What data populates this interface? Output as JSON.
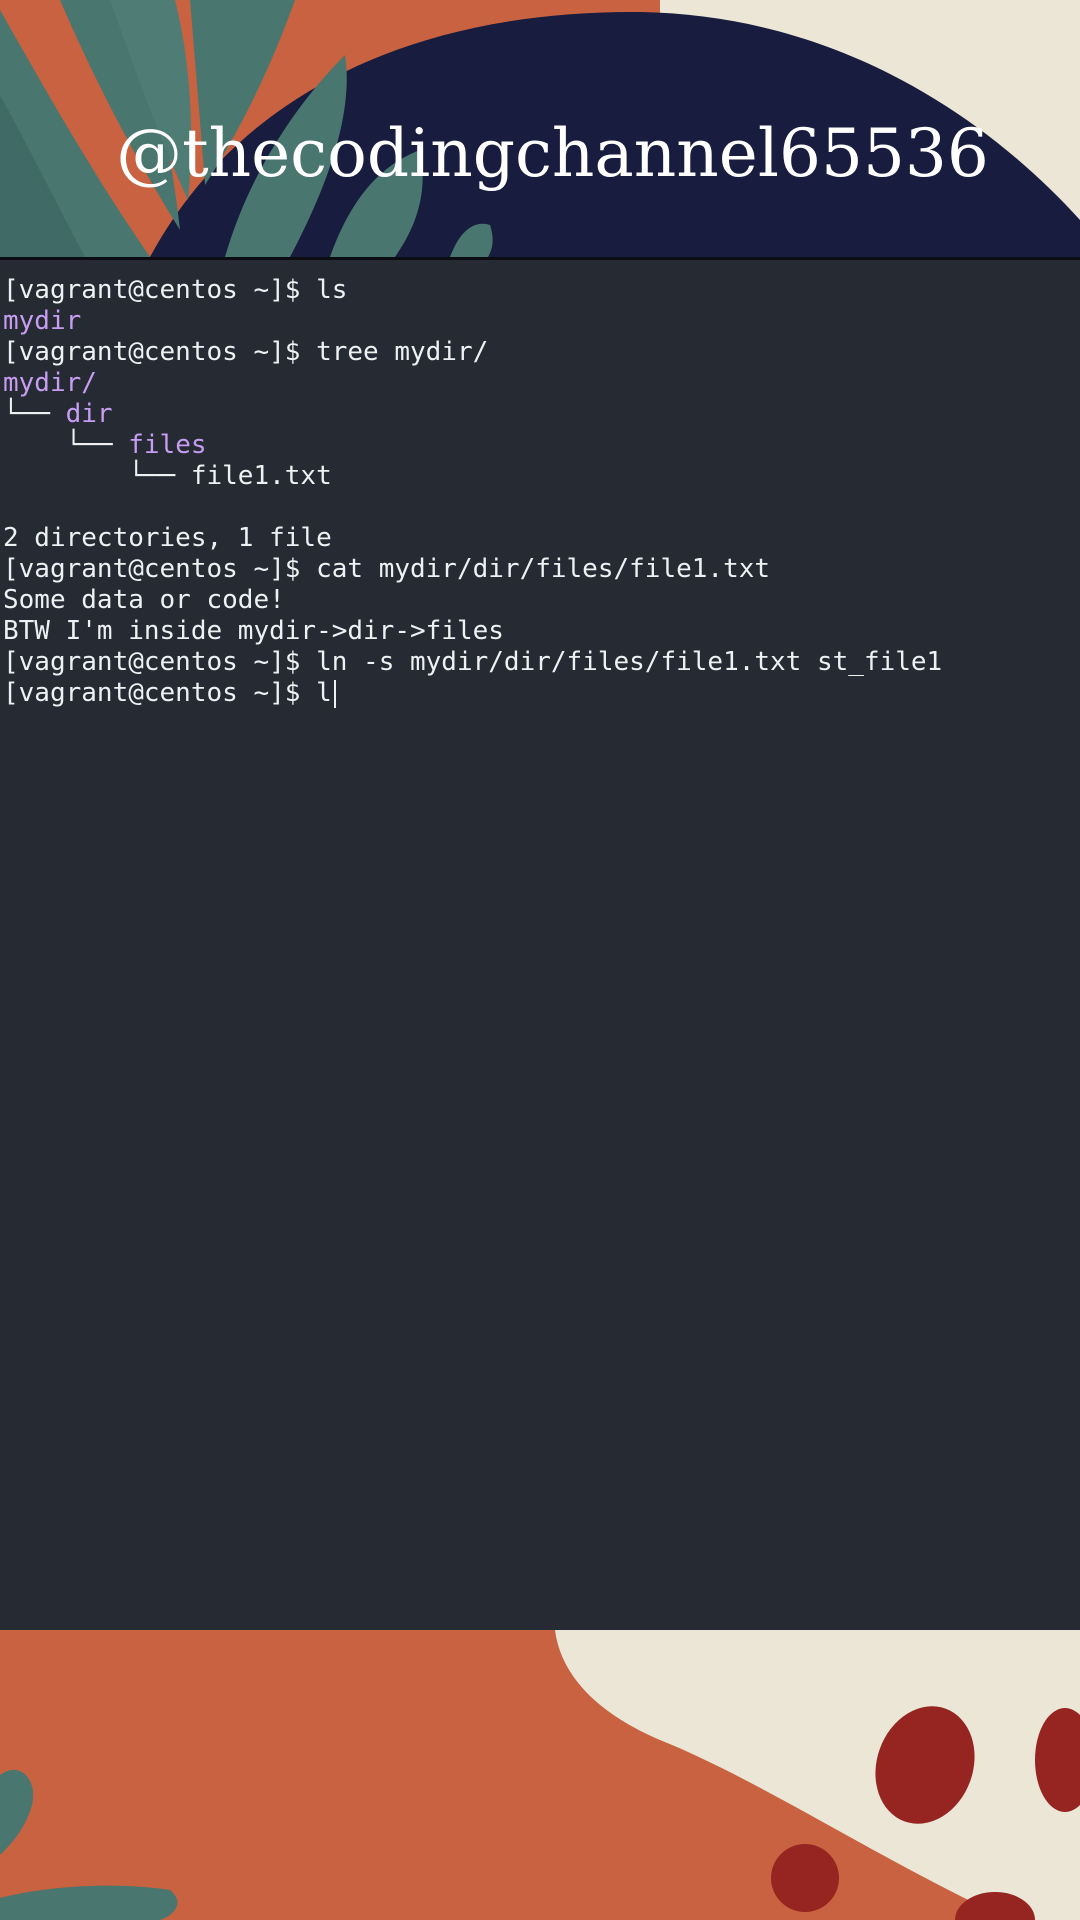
{
  "banner": {
    "handle": "@thecodingchannel65536",
    "colors": {
      "cream": "#ece6d6",
      "orange": "#c86240",
      "navy": "#181c3e",
      "teal": "#4a7670",
      "red": "#962421"
    }
  },
  "terminal": {
    "background": "#252a33",
    "text_color": "#eef0f2",
    "dir_color": "#c69df0",
    "lines": [
      {
        "prefix": "[vagrant@centos ~]$ ",
        "text": "ls"
      },
      {
        "dir": "mydir"
      },
      {
        "prefix": "[vagrant@centos ~]$ ",
        "text": "tree mydir/"
      },
      {
        "dir": "mydir/"
      },
      {
        "prefix": "└── ",
        "dir": "dir"
      },
      {
        "prefix": "    └── ",
        "dir": "files"
      },
      {
        "prefix": "        └── ",
        "text": "file1.txt"
      },
      {
        "text": ""
      },
      {
        "text": "2 directories, 1 file"
      },
      {
        "prefix": "[vagrant@centos ~]$ ",
        "text": "cat mydir/dir/files/file1.txt"
      },
      {
        "text": "Some data or code!"
      },
      {
        "text": "BTW I'm inside mydir->dir->files"
      },
      {
        "prefix": "[vagrant@centos ~]$ ",
        "text": "ln -s mydir/dir/files/file1.txt st_file1"
      },
      {
        "prefix": "[vagrant@centos ~]$ ",
        "text": "l",
        "cursor": true
      }
    ]
  }
}
